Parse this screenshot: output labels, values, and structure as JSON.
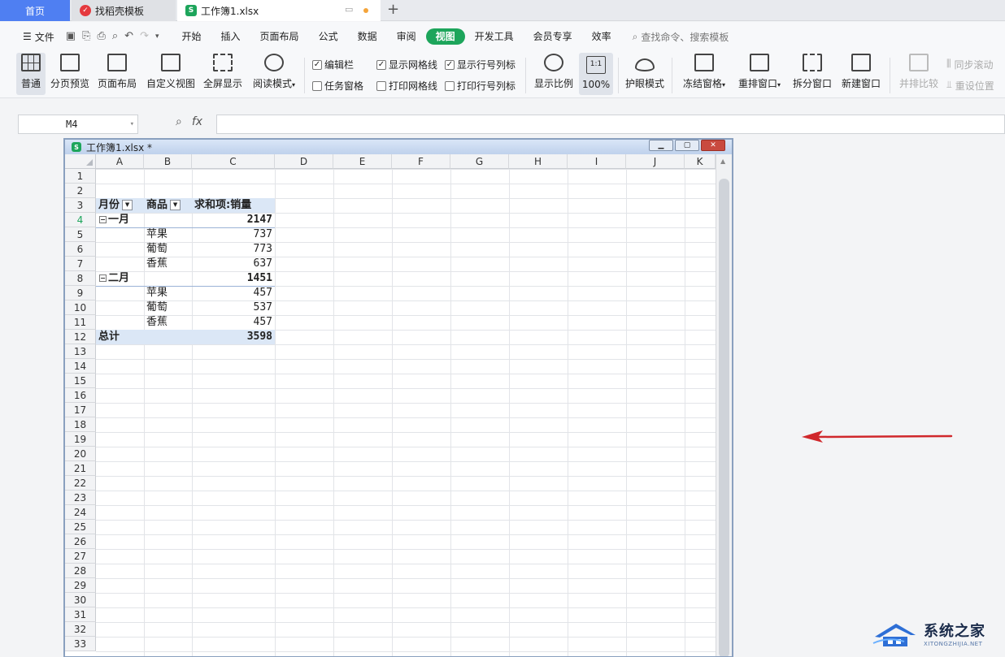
{
  "tabs": {
    "home": "首页",
    "template": "找稻壳模板",
    "workbook": "工作簿1.xlsx",
    "add": "+"
  },
  "menubar": {
    "file": "文件",
    "items": [
      "开始",
      "插入",
      "页面布局",
      "公式",
      "数据",
      "审阅",
      "视图",
      "开发工具",
      "会员专享",
      "效率"
    ],
    "active": "视图",
    "search": "查找命令、搜索模板"
  },
  "ribbon": {
    "normal": "普通",
    "page_break": "分页预览",
    "page_layout": "页面布局",
    "custom_view": "自定义视图",
    "fullscreen": "全屏显示",
    "reading_mode": "阅读模式",
    "formula_bar": "编辑栏",
    "task_pane": "任务窗格",
    "show_gridlines": "显示网格线",
    "print_gridlines": "打印网格线",
    "show_headers": "显示行号列标",
    "print_headers": "打印行号列标",
    "zoom": "显示比例",
    "zoom_100_icon": "1:1",
    "zoom_100": "100%",
    "eye_mode": "护眼模式",
    "freeze": "冻结窗格",
    "arrange": "重排窗口",
    "split": "拆分窗口",
    "new_window": "新建窗口",
    "side_by_side": "并排比较",
    "sync_scroll": "同步滚动",
    "reset_position": "重设位置"
  },
  "formula": {
    "cell_ref": "M4",
    "fx": "fx",
    "value": ""
  },
  "window": {
    "title": "工作簿1.xlsx *"
  },
  "sheet": {
    "columns": [
      "A",
      "B",
      "C",
      "D",
      "E",
      "F",
      "G",
      "H",
      "I",
      "J",
      "K"
    ],
    "rows": [
      "1",
      "2",
      "3",
      "4",
      "5",
      "6",
      "7",
      "8",
      "9",
      "10",
      "11",
      "12",
      "13",
      "14",
      "15",
      "16",
      "17",
      "18",
      "19",
      "20",
      "21",
      "22",
      "23",
      "24",
      "25",
      "26",
      "27",
      "28",
      "29",
      "30",
      "31",
      "32",
      "33"
    ],
    "active_row": "4",
    "pivot": {
      "h_month": "月份",
      "h_item": "商品",
      "h_value": "求和项:销量",
      "g1": "一月",
      "g1_total": "2147",
      "r5_item": "苹果",
      "r5_val": "737",
      "r6_item": "葡萄",
      "r6_val": "773",
      "r7_item": "香蕉",
      "r7_val": "637",
      "g2": "二月",
      "g2_total": "1451",
      "r9_item": "苹果",
      "r9_val": "457",
      "r10_item": "葡萄",
      "r10_val": "537",
      "r11_item": "香蕉",
      "r11_val": "457",
      "total_label": "总计",
      "total_val": "3598"
    }
  },
  "watermark": {
    "cn": "系统之家",
    "en": "XITONGZHIJIA.NET"
  }
}
